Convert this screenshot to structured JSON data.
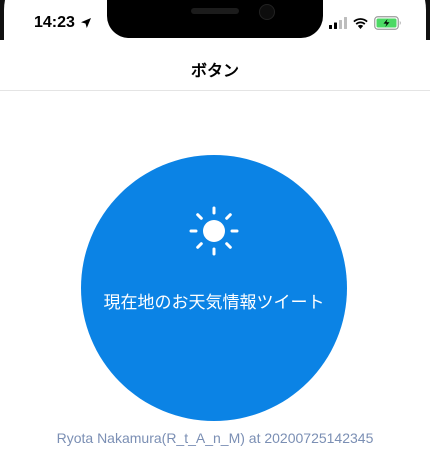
{
  "status_bar": {
    "time": "14:23",
    "location_icon": "location-arrow-icon",
    "signal_icon": "cellular-signal-icon",
    "wifi_icon": "wifi-icon",
    "battery_icon": "battery-charging-icon",
    "battery_color": "#4cd964"
  },
  "nav": {
    "title": "ボタン"
  },
  "weather_button": {
    "label": "現在地のお天気情報ツイート",
    "icon": "sun-icon",
    "color": "#0b83e5"
  },
  "credit": "Ryota Nakamura(R_t_A_n_M) at 20200725142345"
}
